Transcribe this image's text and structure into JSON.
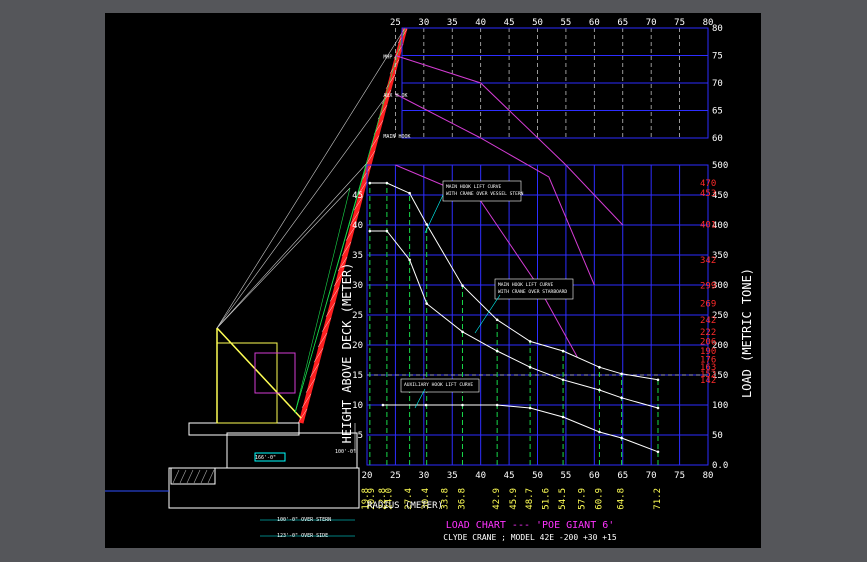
{
  "canvas": {
    "background": "#000000",
    "frame_color": "#55565a"
  },
  "colors": {
    "grid": "#2d2dff",
    "curve_main": "#ffffff",
    "curve_height": "#d33cd3",
    "boom": "#ff2020",
    "lines": "#17d84a",
    "title": "#ff33ff",
    "subtitle": "#ffffff",
    "load_tick": "#ff2a2a"
  },
  "chart_data": {
    "type": "line",
    "title": "LOAD CHART --- 'POE GIANT 6'",
    "subtitle": "CLYDE CRANE ; MODEL 42E -200 +30 +15",
    "xlabel": "RADIUS (METER)",
    "ylabel_left": "HEIGHT ABOVE DECK (METER)",
    "ylabel_right": "LOAD (METRIC TONE)",
    "xlim": [
      20,
      80
    ],
    "ylim_height": [
      0,
      80
    ],
    "ylim_load": [
      0,
      500
    ],
    "x_ticks_top": [
      "25",
      "30",
      "35",
      "40",
      "45",
      "50",
      "55",
      "60",
      "65",
      "70",
      "75",
      "80"
    ],
    "x_ticks_bottom": [
      "20",
      "25",
      "30",
      "35",
      "40",
      "45",
      "50",
      "55",
      "60",
      "65",
      "70",
      "75",
      "80"
    ],
    "height_ticks": [
      "5",
      "10",
      "15",
      "20",
      "25",
      "30",
      "35",
      "40",
      "45"
    ],
    "upper_height_ticks": [
      "60",
      "65",
      "70",
      "75",
      "80"
    ],
    "load_ticks": [
      "0.0",
      "50",
      "100",
      "150",
      "200",
      "250",
      "300",
      "350",
      "400",
      "450",
      "500"
    ],
    "load_marks": [
      "470",
      "453",
      "401",
      "342",
      "299",
      "269",
      "242",
      "222",
      "206",
      "190",
      "176",
      "163",
      "152",
      "142"
    ],
    "radius_marks": [
      "19.8",
      "20.9",
      "22.8",
      "24.0",
      "27.4",
      "30.4",
      "33.8",
      "36.8",
      "42.9",
      "45.9",
      "48.7",
      "51.6",
      "54.5",
      "57.9",
      "60.9",
      "64.8",
      "71.2"
    ],
    "hook_labels": [
      "MHP",
      "AUX H OK",
      "MAIN HOOK"
    ],
    "series": [
      {
        "name": "MAIN HOOK LIFT CURVE WITH CRANE OVER VESSEL STERN",
        "x": [
          20.5,
          23.5,
          27.5,
          30.5,
          36.8,
          42.9,
          48.7,
          54.5,
          60.9,
          64.8,
          71.2
        ],
        "y": [
          470,
          470,
          453,
          401,
          299,
          242,
          206,
          190,
          163,
          152,
          142
        ]
      },
      {
        "name": "MAIN HOOK LIFT CURVE WITH CRANE OVER STARBOARD",
        "x": [
          20.5,
          23.5,
          27.5,
          30.5,
          36.8,
          42.9,
          48.7,
          54.5,
          60.9,
          64.8,
          71.2
        ],
        "y": [
          390,
          390,
          342,
          269,
          222,
          190,
          163,
          142,
          125,
          112,
          95
        ]
      },
      {
        "name": "AUXILIARY HOOK LIFT CURVE",
        "x": [
          22.8,
          30.4,
          36.8,
          42.9,
          48.7,
          54.5,
          60.9,
          64.8,
          71.2
        ],
        "y": [
          100,
          100,
          100,
          100,
          95,
          80,
          55,
          45,
          22
        ]
      }
    ],
    "height_curves": [
      {
        "name": "MHP",
        "x": [
          25,
          40,
          55,
          65
        ],
        "y": [
          75,
          70,
          57,
          40
        ]
      },
      {
        "name": "AUX H OK",
        "x": [
          25,
          40,
          52,
          60
        ],
        "y": [
          68,
          60,
          48,
          30
        ]
      },
      {
        "name": "MAIN HOOK",
        "x": [
          25,
          40,
          50,
          57
        ],
        "y": [
          55,
          44,
          30,
          18
        ]
      }
    ]
  },
  "annotations": {
    "stern_note": [
      "MAIN HOOK LIFT CURVE",
      "WITH CRANE OVER VESSEL STERN"
    ],
    "starboard_note": [
      "MAIN HOOK LIFT CURVE",
      "WITH CRANE OVER STARBOARD"
    ],
    "aux_note": "AUXILIARY HOOK LIFT CURVE",
    "dim_1": "100'-0\"",
    "dim_2": "166'-0\"",
    "dim_3": "100'-0\" OVER STERN",
    "dim_4": "123'-0\" OVER SIDE"
  }
}
